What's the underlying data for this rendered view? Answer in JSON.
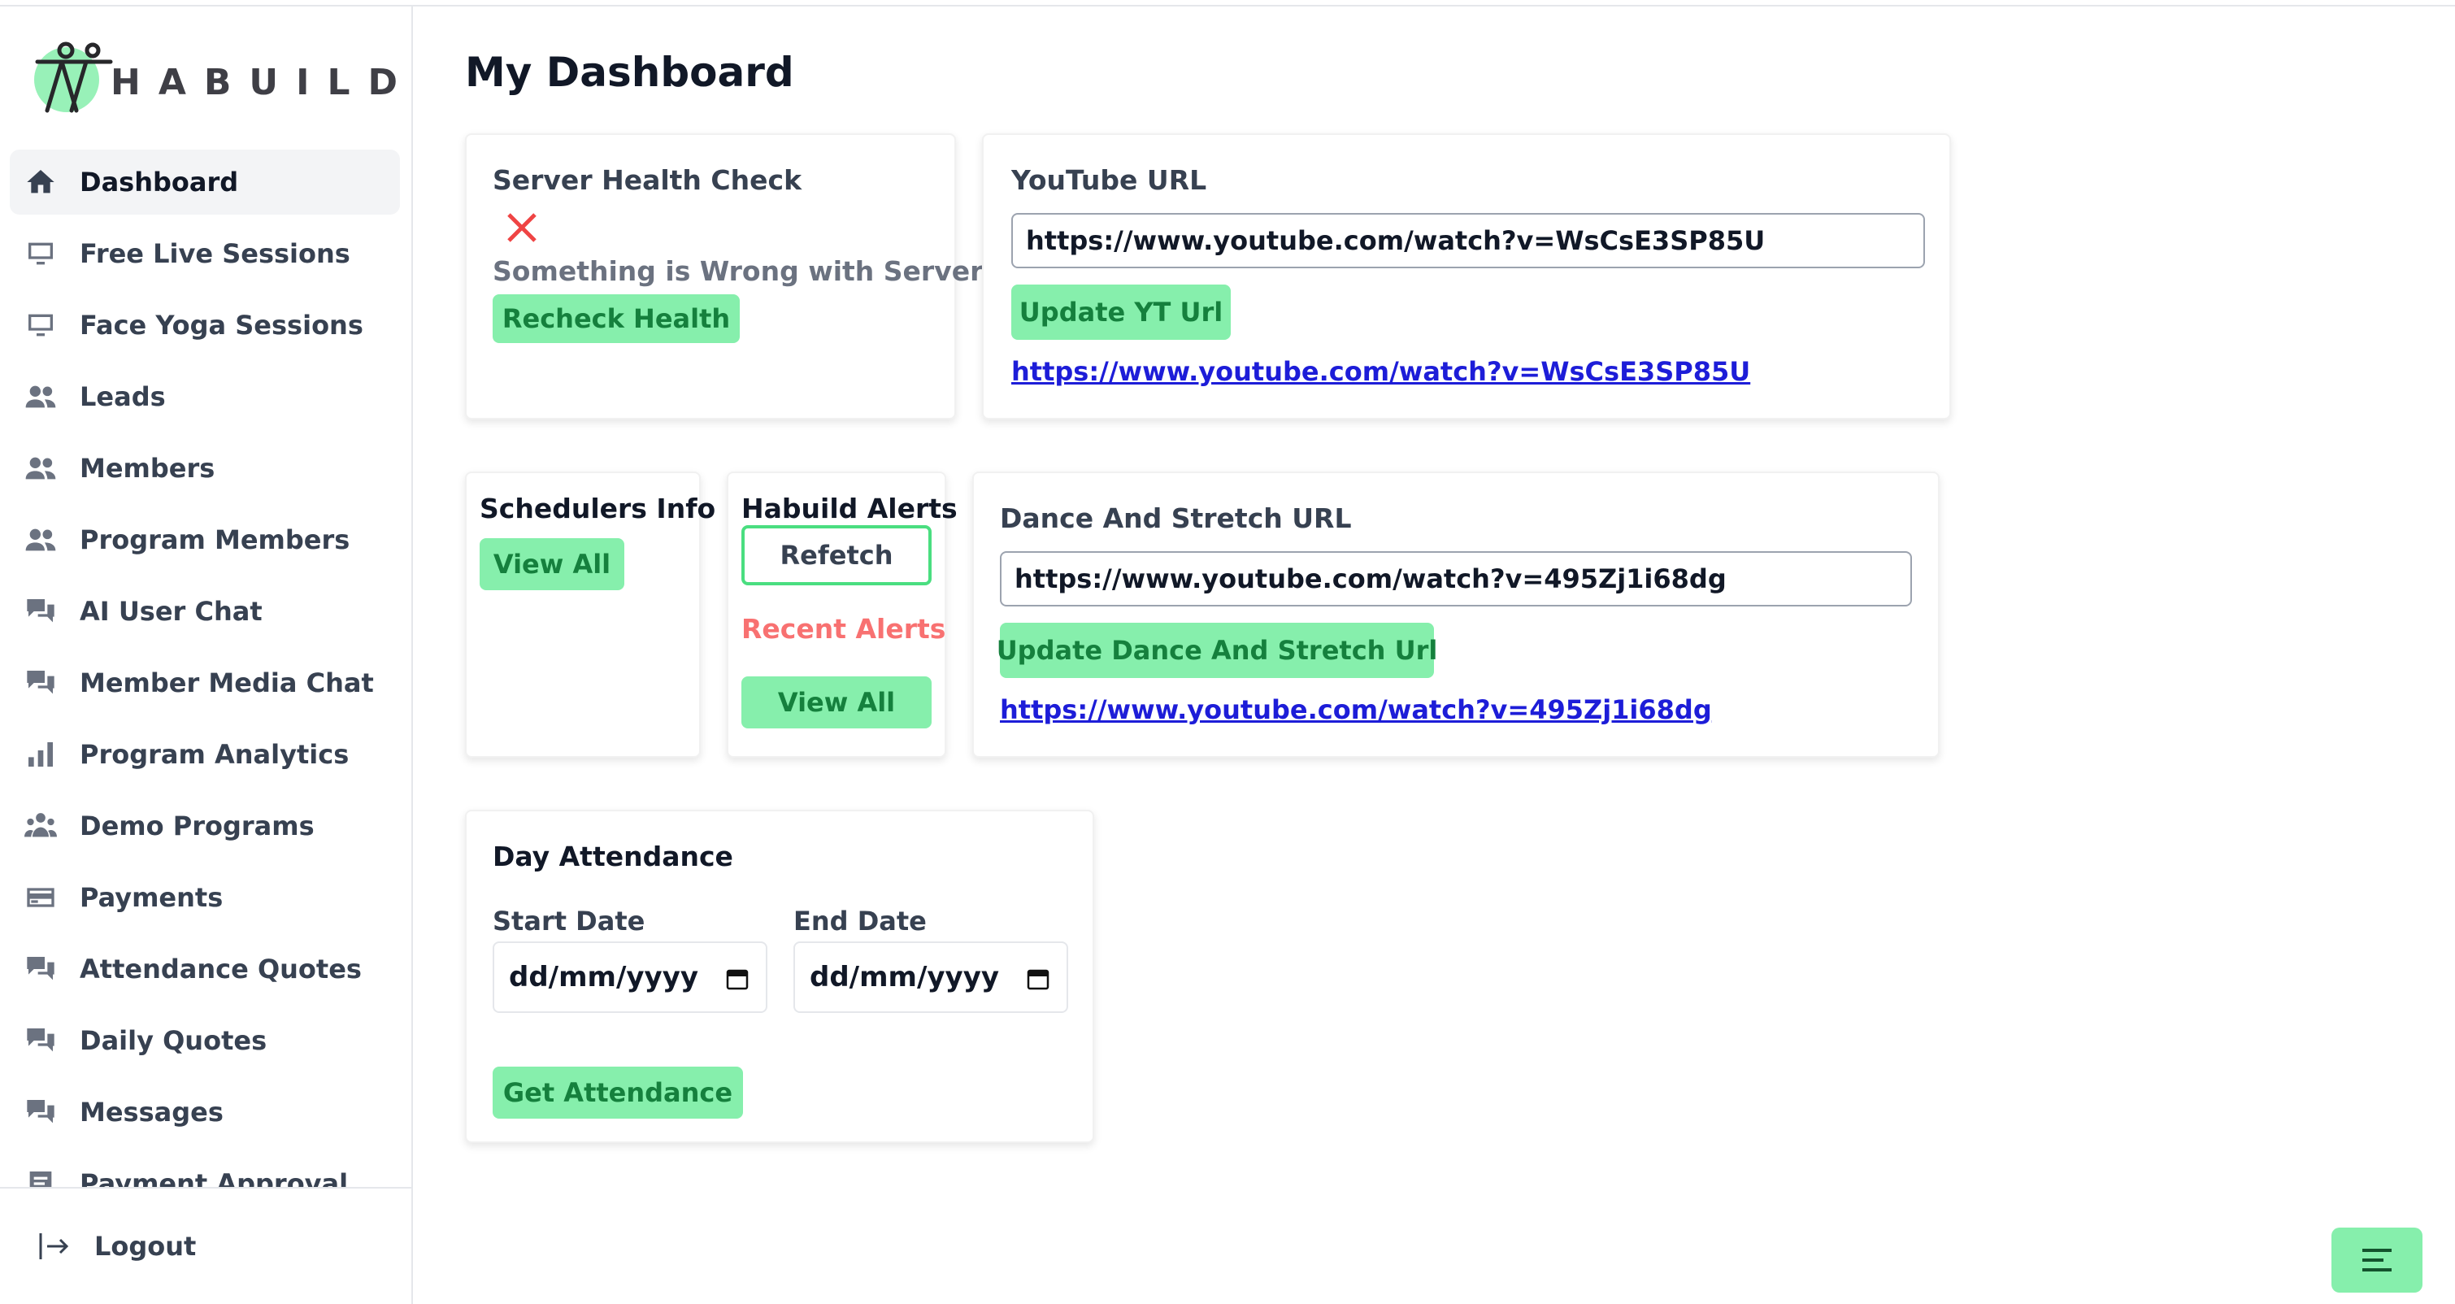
{
  "brand": {
    "name": "HABUILD",
    "logo_icon": "habuild-logo-icon"
  },
  "sidebar": {
    "items": [
      {
        "label": "Dashboard",
        "icon": "home-icon",
        "active": true
      },
      {
        "label": "Free Live Sessions",
        "icon": "monitor-icon"
      },
      {
        "label": "Face Yoga Sessions",
        "icon": "monitor-icon"
      },
      {
        "label": "Leads",
        "icon": "users-icon"
      },
      {
        "label": "Members",
        "icon": "users-icon"
      },
      {
        "label": "Program Members",
        "icon": "users-icon"
      },
      {
        "label": "AI User Chat",
        "icon": "chat-icon"
      },
      {
        "label": "Member Media Chat",
        "icon": "chat-icon"
      },
      {
        "label": "Program Analytics",
        "icon": "bar-chart-icon"
      },
      {
        "label": "Demo Programs",
        "icon": "user-group-icon"
      },
      {
        "label": "Payments",
        "icon": "credit-card-icon"
      },
      {
        "label": "Attendance Quotes",
        "icon": "chat-icon"
      },
      {
        "label": "Daily Quotes",
        "icon": "chat-icon"
      },
      {
        "label": "Messages",
        "icon": "chat-icon"
      },
      {
        "label": "Payment Approval",
        "icon": "receipt-icon"
      }
    ],
    "logout_label": "Logout"
  },
  "main": {
    "title": "My Dashboard",
    "server_health": {
      "title": "Server Health Check",
      "status_icon": "x-icon",
      "message": "Something is Wrong with Server!",
      "button": "Recheck Health"
    },
    "youtube": {
      "title": "YouTube URL",
      "input_value": "https://www.youtube.com/watch?v=WsCsE3SP85U",
      "button": "Update YT Url",
      "link": "https://www.youtube.com/watch?v=WsCsE3SP85U"
    },
    "schedulers": {
      "title": "Schedulers Info",
      "button": "View All"
    },
    "alerts": {
      "title": "Habuild Alerts",
      "refetch_button": "Refetch",
      "recent_label": "Recent Alerts",
      "button": "View All"
    },
    "dance": {
      "title": "Dance And Stretch URL",
      "input_value": "https://www.youtube.com/watch?v=495Zj1i68dg",
      "button": "Update Dance And Stretch Url",
      "link": "https://www.youtube.com/watch?v=495Zj1i68dg"
    },
    "attendance": {
      "title": "Day Attendance",
      "start_label": "Start Date",
      "start_placeholder": "dd/mm/yyyy",
      "end_label": "End Date",
      "end_placeholder": "dd/mm/yyyy",
      "button": "Get Attendance"
    }
  },
  "fab_icon": "menu-lines-icon",
  "colors": {
    "accent": "#86efac",
    "accent_text": "#15803d",
    "error": "#ef4444",
    "link": "#1d1dd8"
  }
}
